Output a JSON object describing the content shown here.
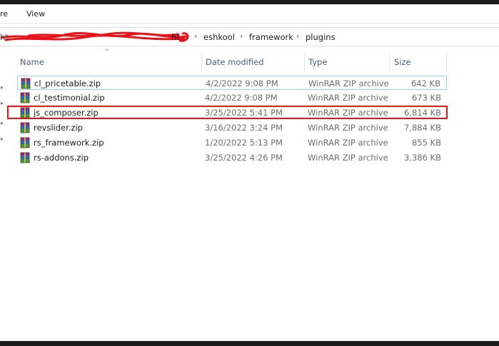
{
  "ribbon": {
    "tabs": [
      {
        "label": "re"
      },
      {
        "label": "View"
      }
    ]
  },
  "address_bar": {
    "crumbs": [
      {
        "label": "ht"
      },
      {
        "label": "eshkool"
      },
      {
        "label": "framework"
      },
      {
        "label": "plugins"
      }
    ],
    "separator": "›",
    "redaction_color": "#e8131b"
  },
  "columns": {
    "name": "Name",
    "date": "Date modified",
    "type": "Type",
    "size": "Size",
    "sort_indicator": "^"
  },
  "files": [
    {
      "name": "cl_pricetable.zip",
      "date": "4/2/2022 9:08 PM",
      "type": "WinRAR ZIP archive",
      "size": "642 KB"
    },
    {
      "name": "cl_testimonial.zip",
      "date": "4/2/2022 9:08 PM",
      "type": "WinRAR ZIP archive",
      "size": "673 KB"
    },
    {
      "name": "js_composer.zip",
      "date": "3/25/2022 5:41 PM",
      "type": "WinRAR ZIP archive",
      "size": "6,814 KB"
    },
    {
      "name": "revslider.zip",
      "date": "3/16/2022 3:24 PM",
      "type": "WinRAR ZIP archive",
      "size": "7,884 KB"
    },
    {
      "name": "rs_framework.zip",
      "date": "1/20/2022 5:13 PM",
      "type": "WinRAR ZIP archive",
      "size": "855 KB"
    },
    {
      "name": "rs-addons.zip",
      "date": "3/25/2022 4:26 PM",
      "type": "WinRAR ZIP archive",
      "size": "3,386 KB"
    }
  ],
  "selected_index": 0,
  "highlighted_index": 2,
  "colors": {
    "highlight": "#e8131b",
    "selection_border": "#99d1ea",
    "header_text": "#4c607a"
  },
  "icons": {
    "file": "winrar-archive-icon",
    "nav": "chevron-right-icon",
    "sort": "sort-up-icon"
  }
}
